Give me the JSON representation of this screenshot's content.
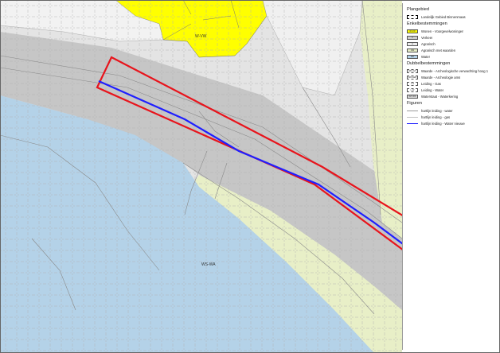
{
  "map": {
    "label_top": "W-VW",
    "label_water": "WS-WA",
    "label_agr": "A"
  },
  "legend": {
    "plangebied_title": "Plangebied",
    "plangebied_item": "Landelijk Gebied Binnenmaas",
    "enkel_title": "Enkelbestemmingen",
    "enkel_items": [
      {
        "code": "W-VW",
        "label": "Wonen - Voorgevelwoningen",
        "color": "#ffff00"
      },
      {
        "code": "V",
        "label": "Verkeer",
        "color": "#cdcdcd"
      },
      {
        "code": "A",
        "label": "Agrarisch",
        "color": "#ededed"
      },
      {
        "code": "AW",
        "label": "Agrarisch met waarden",
        "color": "#e8efc7"
      },
      {
        "code": "WA",
        "label": "Water",
        "color": "#b4d2e8"
      }
    ],
    "dubbel_title": "Dubbelbestemmingen",
    "dubbel_items": [
      {
        "code": "WR-AV3",
        "label": "Waarde - Archeologische verwachting hoog 1"
      },
      {
        "code": "WR-AER",
        "label": "Waarde - Archeologie ams"
      },
      {
        "code": "L-G",
        "label": "Leiding - Gas"
      },
      {
        "code": "L-W",
        "label": "Leiding - Water"
      },
      {
        "code": "WT-WK",
        "label": "Waterstaat - Waterkering"
      }
    ],
    "figuren_title": "Figuren",
    "figuren_items": [
      {
        "label": "hartlijn leiding - water",
        "color": "#9a9a9a"
      },
      {
        "label": "hartlijn leiding - gas",
        "color": "#c0c0c0"
      },
      {
        "label": "hartlijn leiding - Water nieuwe",
        "color": "#1f1fff"
      }
    ]
  }
}
